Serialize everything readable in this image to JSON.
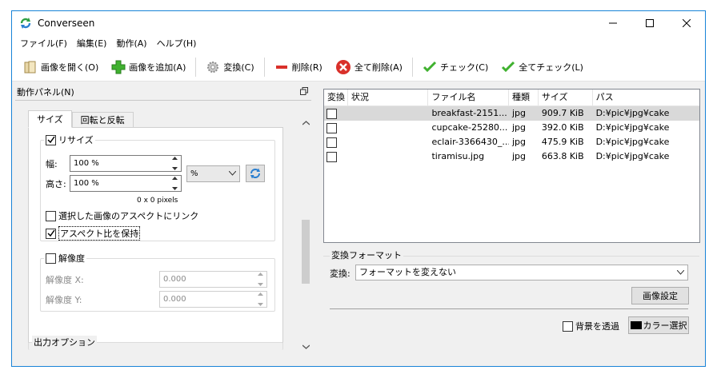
{
  "window": {
    "title": "Converseen"
  },
  "menu": [
    "ファイル(F)",
    "編集(E)",
    "動作(A)",
    "ヘルプ(H)"
  ],
  "toolbar": {
    "open": "画像を開く(O)",
    "add": "画像を追加(A)",
    "convert": "変換(C)",
    "delete": "削除(R)",
    "delete_all": "全て削除(A)",
    "check": "チェック(C)",
    "check_all": "全てチェック(L)"
  },
  "dock": {
    "title": "動作パネル(N)"
  },
  "tabs": [
    "サイズ",
    "回転と反転"
  ],
  "resize": {
    "label": "リサイズ",
    "checked": true,
    "width_label": "幅:",
    "width_value": "100 %",
    "height_label": "高さ:",
    "height_value": "100 %",
    "unit": "%",
    "pixels": "0 x 0 pixels",
    "link_aspect": "選択した画像のアスペクトにリンク",
    "link_aspect_checked": false,
    "keep_aspect": "アスペクト比を保持",
    "keep_aspect_checked": true
  },
  "resolution": {
    "label": "解像度",
    "checked": false,
    "x_label": "解像度 X:",
    "x_value": "0.000",
    "y_label": "解像度 Y:",
    "y_value": "0.000"
  },
  "output_options": {
    "label": "出力オプション"
  },
  "file_table": {
    "columns": [
      "変換",
      "状況",
      "ファイル名",
      "種類",
      "サイズ",
      "パス"
    ],
    "rows": [
      {
        "name": "breakfast-2151...",
        "type": "jpg",
        "size": "909.7 KiB",
        "path": "D:¥pic¥jpg¥cake",
        "selected": true
      },
      {
        "name": "cupcake-25280...",
        "type": "jpg",
        "size": "392.0 KiB",
        "path": "D:¥pic¥jpg¥cake",
        "selected": false
      },
      {
        "name": "eclair-3366430_...",
        "type": "jpg",
        "size": "475.9 KiB",
        "path": "D:¥pic¥jpg¥cake",
        "selected": false
      },
      {
        "name": "tiramisu.jpg",
        "type": "jpg",
        "size": "663.8 KiB",
        "path": "D:¥pic¥jpg¥cake",
        "selected": false
      }
    ]
  },
  "format": {
    "title": "変換フォーマット",
    "label": "変換:",
    "value": "フォーマットを変えない",
    "image_settings": "画像設定",
    "transparent_bg": "背景を透過",
    "color_select": "カラー選択"
  },
  "colors": {
    "accent": "#1883d7",
    "selection": "#d9d9d9",
    "swatch": "#000000"
  }
}
